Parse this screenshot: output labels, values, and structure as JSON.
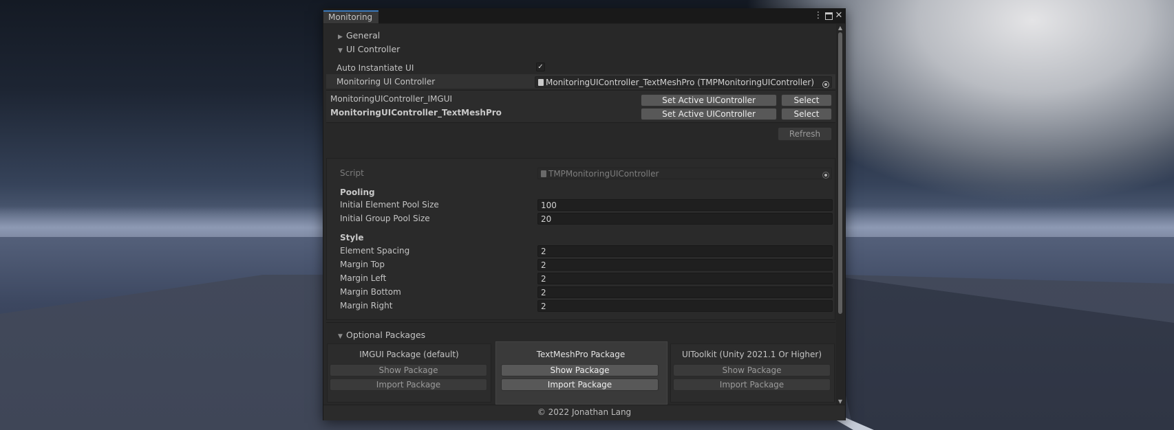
{
  "window": {
    "tab_title": "Monitoring",
    "icons": [
      "more-vert-icon",
      "maximize-icon",
      "close-icon"
    ]
  },
  "sections": {
    "general": "General",
    "ui_controller": "UI Controller",
    "optional_packages": "Optional Packages"
  },
  "ui_controller": {
    "auto_instantiate_label": "Auto Instantiate UI",
    "auto_instantiate_checked": true,
    "controller_label": "Monitoring UI Controller",
    "controller_value": "MonitoringUIController_TextMeshPro (TMPMonitoringUIController)",
    "list": [
      {
        "name": "MonitoringUIController_IMGUI",
        "set_label": "Set Active UIController",
        "select_label": "Select",
        "active": false
      },
      {
        "name": "MonitoringUIController_TextMeshPro",
        "set_label": "Set Active UIController",
        "select_label": "Select",
        "active": true
      }
    ],
    "refresh_label": "Refresh"
  },
  "inspector": {
    "script_label": "Script",
    "script_value": "TMPMonitoringUIController",
    "pooling_header": "Pooling",
    "initial_element_pool_label": "Initial Element Pool Size",
    "initial_element_pool_value": "100",
    "initial_group_pool_label": "Initial Group Pool Size",
    "initial_group_pool_value": "20",
    "style_header": "Style",
    "element_spacing_label": "Element Spacing",
    "element_spacing_value": "2",
    "margin_top_label": "Margin Top",
    "margin_top_value": "2",
    "margin_left_label": "Margin Left",
    "margin_left_value": "2",
    "margin_bottom_label": "Margin Bottom",
    "margin_bottom_value": "2",
    "margin_right_label": "Margin Right",
    "margin_right_value": "2"
  },
  "packages": [
    {
      "title": "IMGUI Package (default)",
      "show_label": "Show Package",
      "import_label": "Import Package",
      "highlighted": false
    },
    {
      "title": "TextMeshPro Package",
      "show_label": "Show Package",
      "import_label": "Import Package",
      "highlighted": true
    },
    {
      "title": "UIToolkit (Unity 2021.1 Or Higher)",
      "show_label": "Show Package",
      "import_label": "Import Package",
      "highlighted": false
    }
  ],
  "footer": "© 2022 Jonathan Lang",
  "colors": {
    "window_bg": "#282828",
    "tab_accent": "#3a79bb",
    "button_bg": "#585858"
  }
}
